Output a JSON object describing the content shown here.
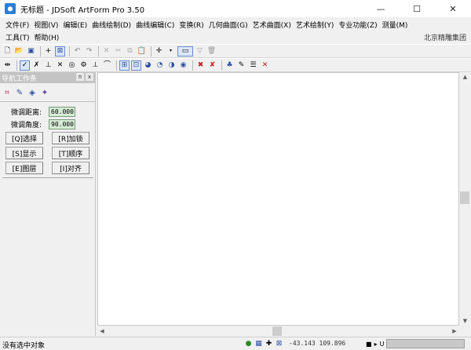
{
  "window": {
    "title": "无标题 - JDSoft ArtForm Pro 3.50",
    "minimize_glyph": "—",
    "maximize_glyph": "☐",
    "close_glyph": "✕"
  },
  "menu": {
    "row1": [
      "文件(F)",
      "视图(V)",
      "编辑(E)",
      "曲线绘制(D)",
      "曲线编辑(C)",
      "变换(R)",
      "几何曲面(G)",
      "艺术曲面(X)",
      "艺术绘制(Y)",
      "专业功能(Z)",
      "测量(M)"
    ],
    "row2": [
      "工具(T)",
      "帮助(H)"
    ],
    "company": "北京精雕集团"
  },
  "toolbar1": {
    "icons": [
      "new-file-icon",
      "open-file-icon",
      "save-icon",
      "add-icon",
      "window-icon",
      "undo-icon",
      "redo-icon",
      "delete-icon",
      "cut-icon",
      "copy-icon",
      "paste-icon",
      "snap-cross-icon",
      "view-box-icon",
      "filter-icon",
      "trash-icon"
    ]
  },
  "toolbar2": {
    "icons": [
      "arrow-pick-icon",
      "check-icon",
      "cross-check-icon",
      "plus-line-icon",
      "x-line-icon",
      "circle-target-icon",
      "gear-target-icon",
      "perpendicular-icon",
      "tangent-icon",
      "grid-snap-icon",
      "grid-snap-alt-icon",
      "lasso-icon",
      "lasso-plus-icon",
      "lasso-minus-icon",
      "pin-icon",
      "pin-x-icon",
      "brush-icon",
      "measure-icon",
      "layer-icon",
      "delete-x-icon"
    ]
  },
  "nav_panel": {
    "title": "导航工作条",
    "pin_glyph": "ᴨ",
    "close_glyph": "x",
    "fine_distance_label": "微调距离:",
    "fine_distance_value": "60.000",
    "fine_angle_label": "微调角度:",
    "fine_angle_value": "90.000",
    "buttons": {
      "select": "[Q]选择",
      "lock": "[R]加锁",
      "display": "[S]显示",
      "order": "[T]顺序",
      "layer": "[E]图层",
      "align": "[I]对齐"
    }
  },
  "statusbar": {
    "message": "没有选中对象",
    "coords": "-43.143  109.896",
    "unit": "U"
  },
  "colors": {
    "input_bg": "#d6ecd6",
    "accent": "#2a7fd4",
    "delete_red": "#cc2020"
  }
}
